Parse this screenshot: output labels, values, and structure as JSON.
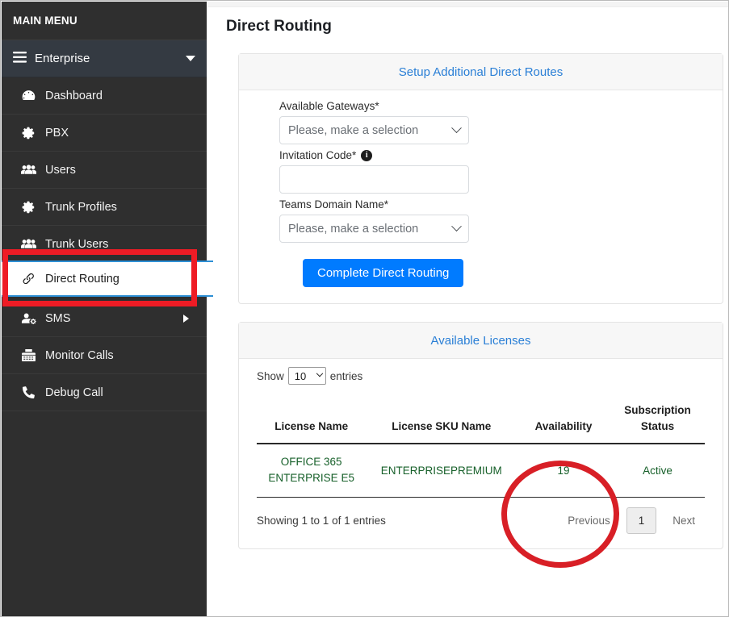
{
  "sidebar": {
    "header": "MAIN MENU",
    "enterprise": {
      "label": "Enterprise",
      "icon": "bars-icon",
      "caret": "chevron-down-icon"
    },
    "items": [
      {
        "label": "Dashboard",
        "icon": "tachometer-icon",
        "active": false
      },
      {
        "label": "PBX",
        "icon": "gear-icon",
        "active": false
      },
      {
        "label": "Users",
        "icon": "users-icon",
        "active": false
      },
      {
        "label": "Trunk Profiles",
        "icon": "gear-icon",
        "active": false
      },
      {
        "label": "Trunk Users",
        "icon": "users-icon",
        "active": false
      },
      {
        "label": "SMS",
        "icon": "user-cog-icon",
        "active": false,
        "caret": "chevron-right-icon"
      },
      {
        "label": "Monitor Calls",
        "icon": "fax-icon",
        "active": false
      },
      {
        "label": "Debug Call",
        "icon": "phone-icon",
        "active": false
      }
    ],
    "active_item": {
      "label": "Direct Routing",
      "icon": "link-icon"
    }
  },
  "page": {
    "title": "Direct Routing"
  },
  "setup_panel": {
    "heading": "Setup Additional Direct Routes",
    "fields": [
      {
        "label": "Available Gateways*",
        "type": "select",
        "value": "Please, make a selection",
        "info": false
      },
      {
        "label": "Invitation Code*",
        "type": "text",
        "value": "",
        "placeholder": "",
        "info": true,
        "info_icon": "info-circle-icon"
      },
      {
        "label": "Teams Domain Name*",
        "type": "select",
        "value": "Please, make a selection",
        "info": false
      }
    ],
    "submit_label": "Complete Direct Routing"
  },
  "licenses_panel": {
    "heading": "Available Licenses",
    "length_menu": {
      "prefix": "Show",
      "value": "10",
      "suffix": "entries"
    },
    "columns": [
      "License Name",
      "License SKU Name",
      "Availability",
      "Subscription Status"
    ],
    "rows": [
      {
        "license_name": "OFFICE 365 ENTERPRISE E5",
        "license_sku_name": "ENTERPRISEPREMIUM",
        "availability": "19",
        "subscription_status": "Active"
      }
    ],
    "info": "Showing 1 to 1 of 1 entries",
    "pagination": {
      "previous": "Previous",
      "current_page": "1",
      "next": "Next"
    }
  },
  "annotations": {
    "highlight_rect_color": "#ee1c25",
    "highlight_ellipse_color": "#d81f26"
  },
  "colors": {
    "sidebar_bg": "#2f2f2f",
    "sidebar_section_bg": "#343a42",
    "accent_blue": "#007bff",
    "link_blue": "#2a7fd6",
    "table_text_green": "#17602a",
    "active_border_blue": "#2d8fd5"
  }
}
